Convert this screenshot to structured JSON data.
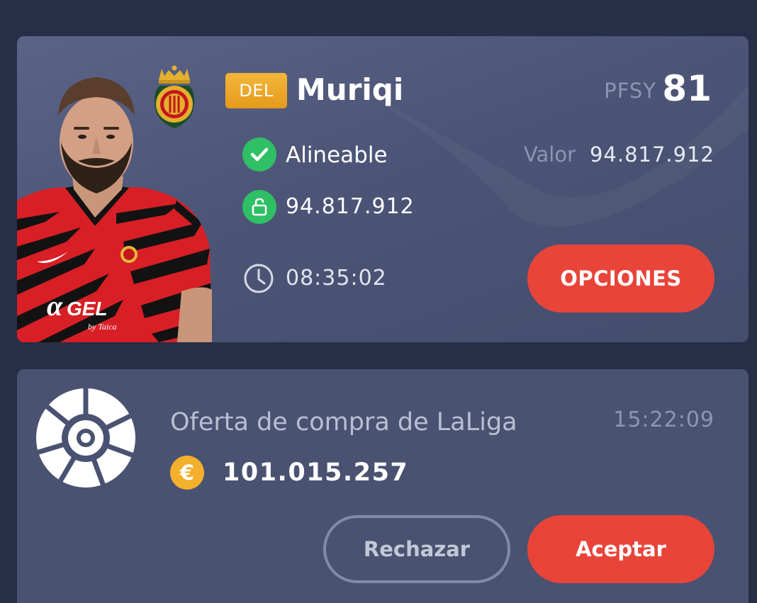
{
  "player": {
    "position": "DEL",
    "name": "Muriqi",
    "score_label": "PFSY",
    "score": "81",
    "status": "Alineable",
    "value_label": "Valor",
    "value": "94.817.912",
    "clause": "94.817.912",
    "timer": "08:35:02",
    "options_label": "OPCIONES",
    "photo_icon": "player-photo",
    "club_icon": "rcd-mallorca-crest"
  },
  "offer": {
    "title": "Oferta de compra de LaLiga",
    "time": "15:22:09",
    "currency_symbol": "€",
    "amount": "101.015.257",
    "reject_label": "Rechazar",
    "accept_label": "Aceptar",
    "logo_icon": "laliga-logo"
  },
  "colors": {
    "background": "#272e47",
    "card": "#4c5577",
    "accent_red": "#e8443a",
    "status_green": "#2fbf65",
    "position_badge": "#f3b63a",
    "coin": "#f3b02d"
  }
}
